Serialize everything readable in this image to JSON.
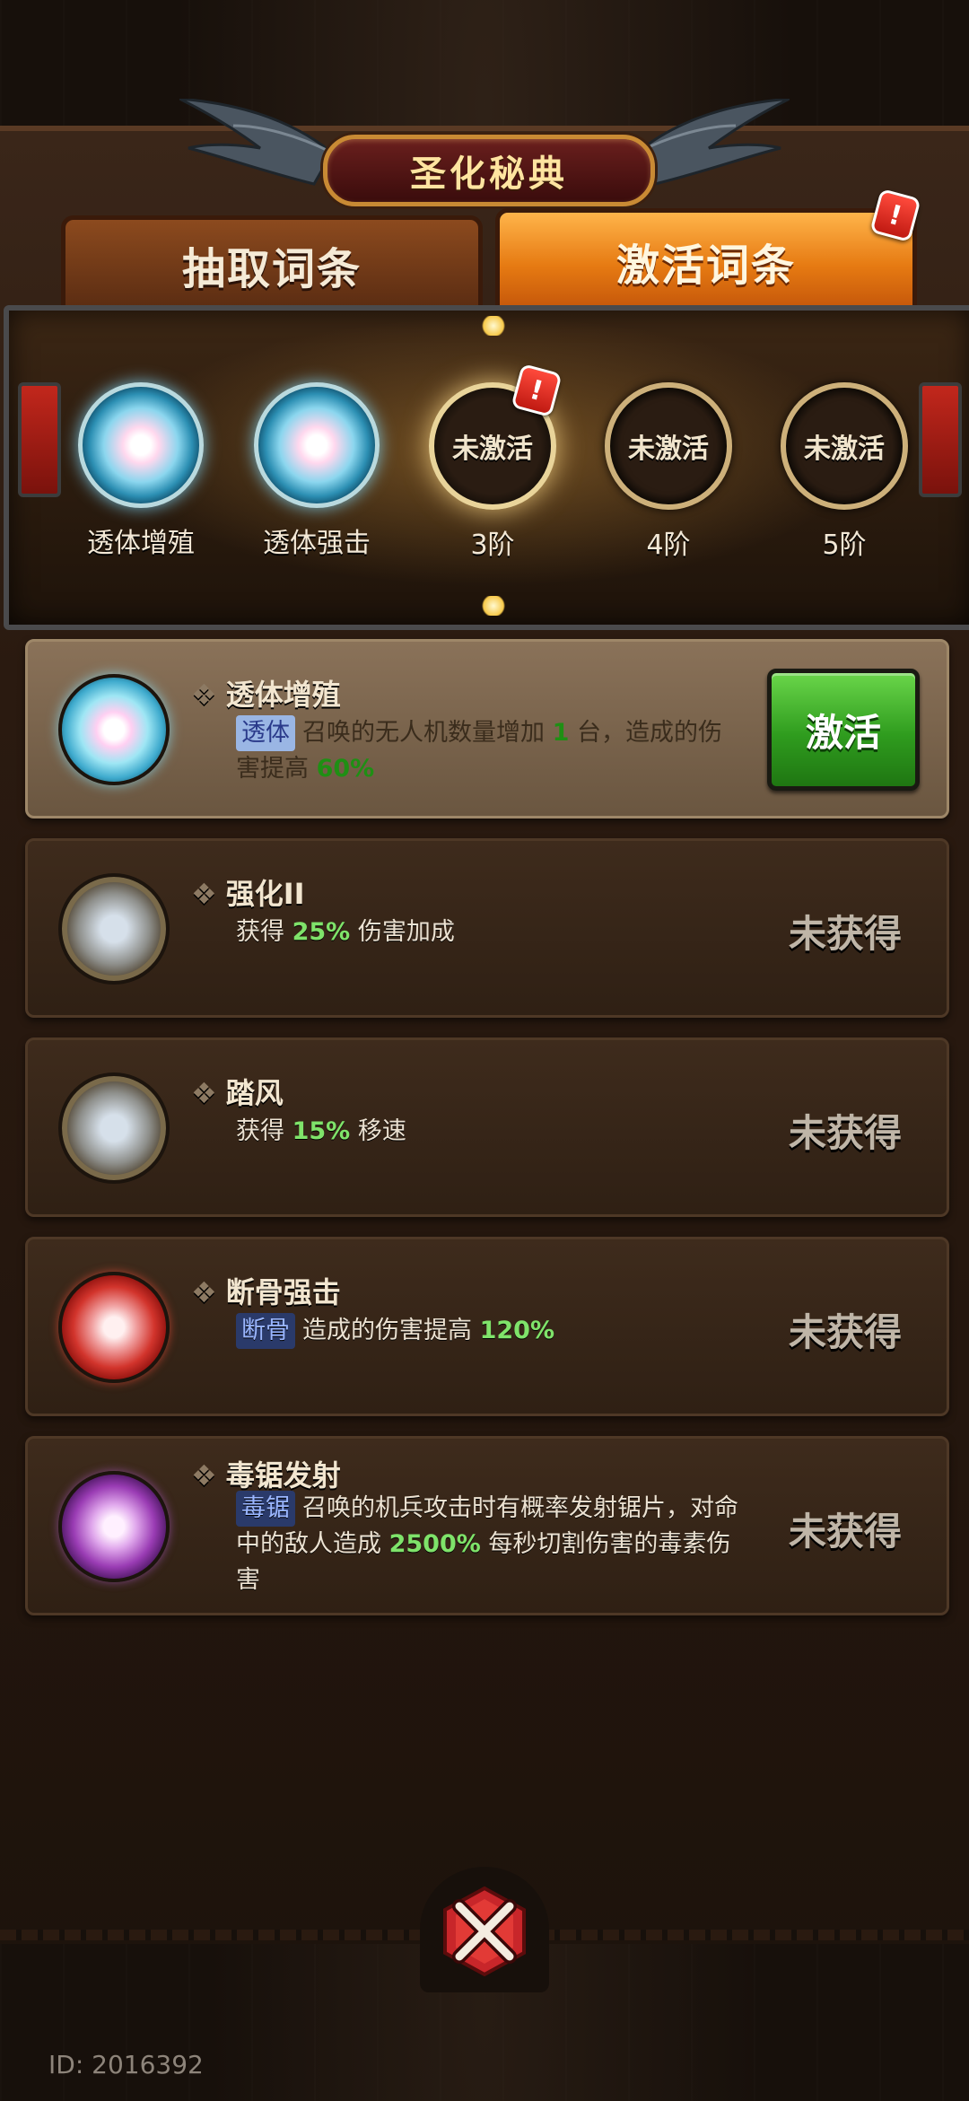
{
  "title": "圣化秘典",
  "tabs": [
    {
      "label": "抽取词条",
      "active": false
    },
    {
      "label": "激活词条",
      "active": true,
      "alert": "!"
    }
  ],
  "stages": [
    {
      "label": "透体增殖",
      "state": "active"
    },
    {
      "label": "透体强击",
      "state": "active"
    },
    {
      "label": "3阶",
      "state": "inactive",
      "ring_text": "未激活",
      "current": true,
      "alert": "!"
    },
    {
      "label": "4阶",
      "state": "inactive",
      "ring_text": "未激活"
    },
    {
      "label": "5阶",
      "state": "inactive",
      "ring_text": "未激活"
    }
  ],
  "cards": [
    {
      "title": "透体增殖",
      "orb": "cyan",
      "selected": true,
      "tag": "透体",
      "desc_parts": [
        "召唤的无人机数量增加",
        "1",
        "台，造成的伤害提高",
        "60%"
      ],
      "action": "激活"
    },
    {
      "title": "强化II",
      "orb": "gray",
      "desc_parts": [
        "获得",
        "25%",
        "伤害加成"
      ],
      "status": "未获得"
    },
    {
      "title": "踏风",
      "orb": "gray",
      "desc_parts": [
        "获得",
        "15%",
        "移速"
      ],
      "status": "未获得"
    },
    {
      "title": "断骨强击",
      "orb": "red",
      "tag": "断骨",
      "desc_parts": [
        "造成的伤害提高",
        "120%"
      ],
      "status": "未获得"
    },
    {
      "title": "毒锯发射",
      "orb": "purple",
      "tag": "毒锯",
      "desc_parts": [
        "召唤的机兵攻击时有概率发射锯片，对命中的敌人造成",
        "2500%",
        "每秒切割伤害的毒素伤害"
      ],
      "status": "未获得"
    }
  ],
  "footer": {
    "id": "ID: 2016392"
  },
  "colors": {
    "tab_active": "#e67a12",
    "activate_button": "#2f9c1e",
    "highlight": "#7fe36a",
    "alert": "#c01a12"
  }
}
